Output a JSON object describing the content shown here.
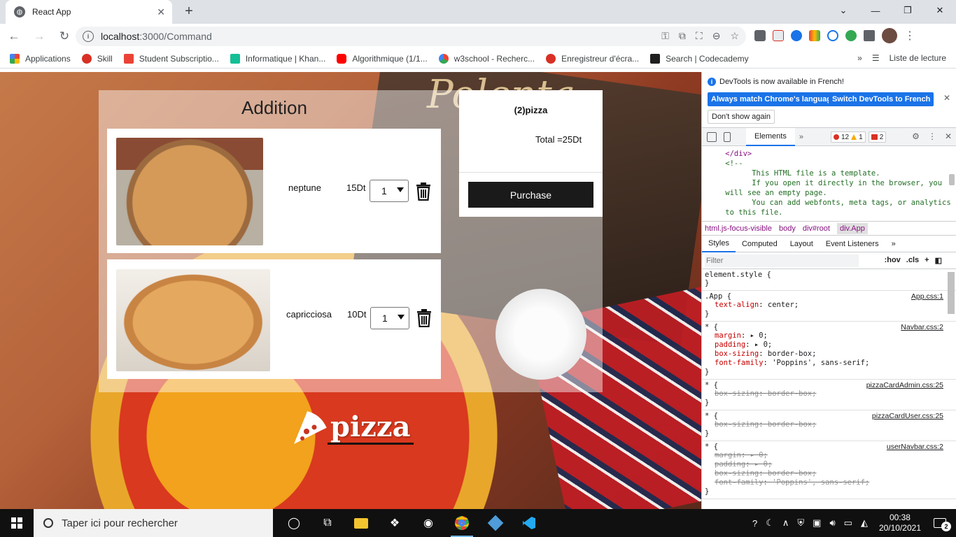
{
  "browser": {
    "tab_title": "React App",
    "url_host": "localhost",
    "url_path": ":3000/Command",
    "bookmarks": [
      {
        "label": "Applications",
        "color": "#4285f4"
      },
      {
        "label": "Skill",
        "color": "#d93025"
      },
      {
        "label": "Student Subscriptio...",
        "color": "#ea4335"
      },
      {
        "label": "Informatique | Khan...",
        "color": "#14bf96"
      },
      {
        "label": "Algorithmique (1/1...",
        "color": "#ff0000"
      },
      {
        "label": "w3school - Recherc...",
        "color": "#4285f4"
      },
      {
        "label": "Enregistreur d'écra...",
        "color": "#d93025"
      },
      {
        "label": "Search | Codecademy",
        "color": "#1f1f1f"
      }
    ],
    "reading_list": "Liste de lecture"
  },
  "page": {
    "heading": "Addition",
    "items": [
      {
        "name": "neptune",
        "price": "15Dt",
        "qty": "1"
      },
      {
        "name": "capricciosa",
        "price": "10Dt",
        "qty": "1"
      }
    ],
    "summary": {
      "title": "(2)pizza",
      "total_label": "Total =",
      "total_value": "25Dt",
      "purchase_label": "Purchase"
    },
    "logo_text": "pizza",
    "background_sign_text": "Polenta"
  },
  "devtools": {
    "info_message": "DevTools is now available in French!",
    "btn_match": "Always match Chrome's language",
    "btn_switch": "Switch DevTools to French",
    "btn_dont_show": "Don't show again",
    "tab_elements": "Elements",
    "errors": "12",
    "warnings": "1",
    "issues": "2",
    "dom_lines": [
      "    </div>",
      "    <!--",
      "          This HTML file is a template.",
      "          If you open it directly in the browser, you",
      "    will see an empty page.",
      "",
      "          You can add webfonts, meta tags, or analytics",
      "    to this file."
    ],
    "crumbs": [
      "html.js-focus-visible",
      "body",
      "div#root",
      "div.App"
    ],
    "subtabs": [
      "Styles",
      "Computed",
      "Layout",
      "Event Listeners"
    ],
    "filter_placeholder": "Filter",
    "hov": ":hov",
    "cls": ".cls",
    "rules": [
      {
        "selector": "element.style {",
        "source": "",
        "props": []
      },
      {
        "selector": ".App {",
        "source": "App.css:1",
        "props": [
          {
            "n": "text-align",
            "v": "center;",
            "struck": false
          }
        ]
      },
      {
        "selector": "* {",
        "source": "Navbar.css:2",
        "props": [
          {
            "n": "margin",
            "v": "▸ 0;",
            "struck": false
          },
          {
            "n": "padding",
            "v": "▸ 0;",
            "struck": false
          },
          {
            "n": "box-sizing",
            "v": "border-box;",
            "struck": false
          },
          {
            "n": "font-family",
            "v": "'Poppins', sans-serif;",
            "struck": false
          }
        ]
      },
      {
        "selector": "* {",
        "source": "pizzaCardAdmin.css:25",
        "props": [
          {
            "n": "box-sizing",
            "v": "border-box;",
            "struck": true
          }
        ]
      },
      {
        "selector": "* {",
        "source": "pizzaCardUser.css:25",
        "props": [
          {
            "n": "box-sizing",
            "v": "border-box;",
            "struck": true
          }
        ]
      },
      {
        "selector": "* {",
        "source": "userNavbar.css:2",
        "props": [
          {
            "n": "margin",
            "v": "▸ 0;",
            "struck": true
          },
          {
            "n": "padding",
            "v": "▸ 0;",
            "struck": true
          },
          {
            "n": "box-sizing",
            "v": "border-box;",
            "struck": true
          },
          {
            "n": "font-family",
            "v": "'Poppins', sans-serif;",
            "struck": true
          }
        ]
      }
    ]
  },
  "taskbar": {
    "search_placeholder": "Taper ici pour rechercher",
    "time": "00:38",
    "date": "20/10/2021",
    "notifications": "2"
  }
}
